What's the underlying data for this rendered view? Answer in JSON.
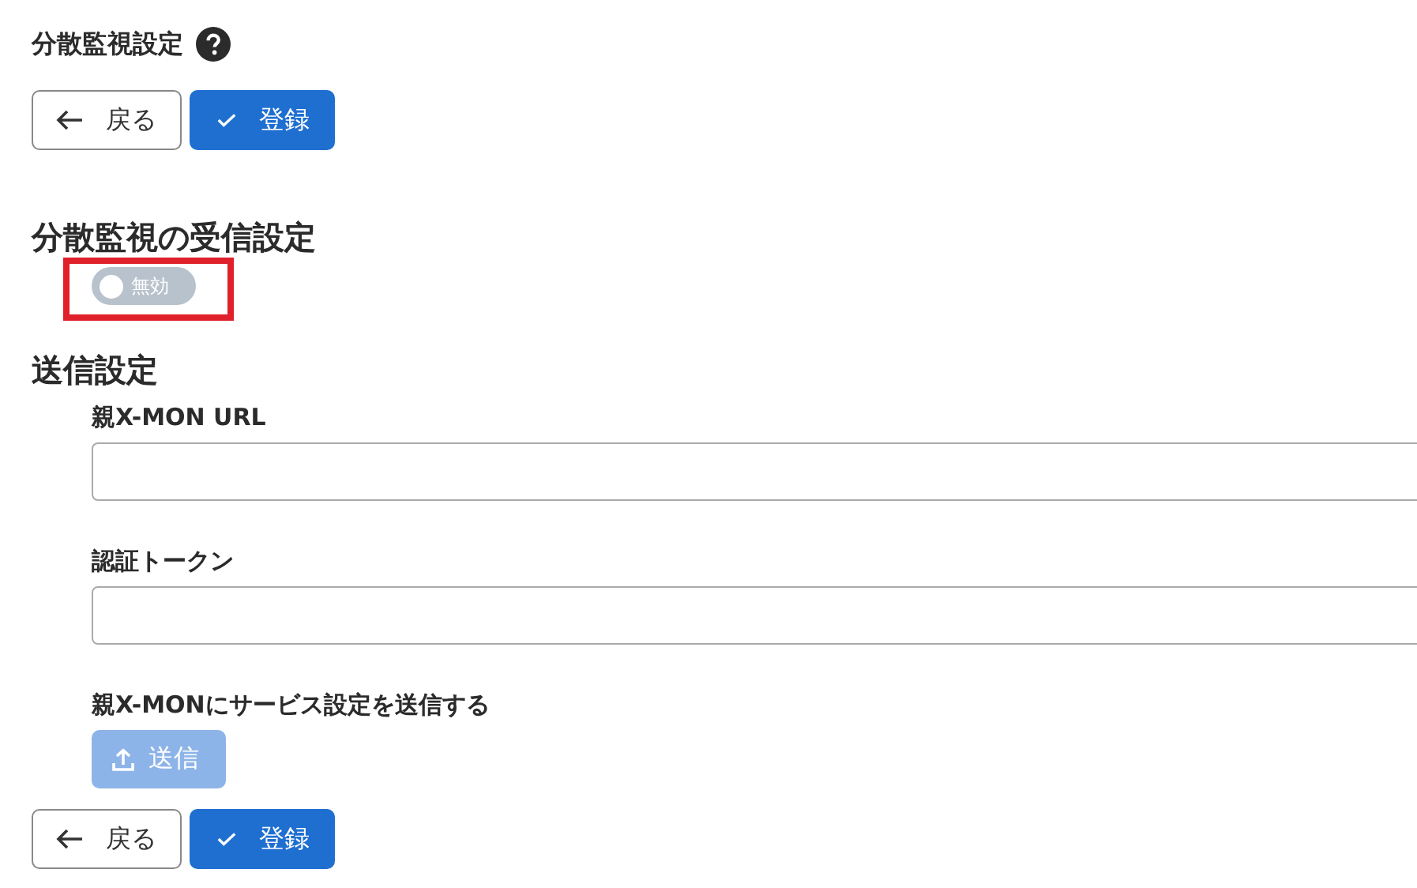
{
  "page_title": "分散監視設定",
  "top_buttons": [
    {
      "kind": "back",
      "label": "戻る"
    },
    {
      "kind": "submit",
      "label": "登録"
    }
  ],
  "receive_section": {
    "heading": "分散監視の受信設定",
    "toggle": {
      "label": "無効",
      "on": false
    }
  },
  "send_section": {
    "heading": "送信設定",
    "fields": [
      {
        "label": "親X-MON URL"
      },
      {
        "label": "認証トークン"
      }
    ],
    "send_label": "親X-MONにサービス設定を送信する",
    "send_button": {
      "label": "送信",
      "disabled": true
    }
  },
  "bottom_buttons": [
    {
      "kind": "back",
      "label": "戻る"
    },
    {
      "kind": "submit",
      "label": "登録"
    }
  ]
}
